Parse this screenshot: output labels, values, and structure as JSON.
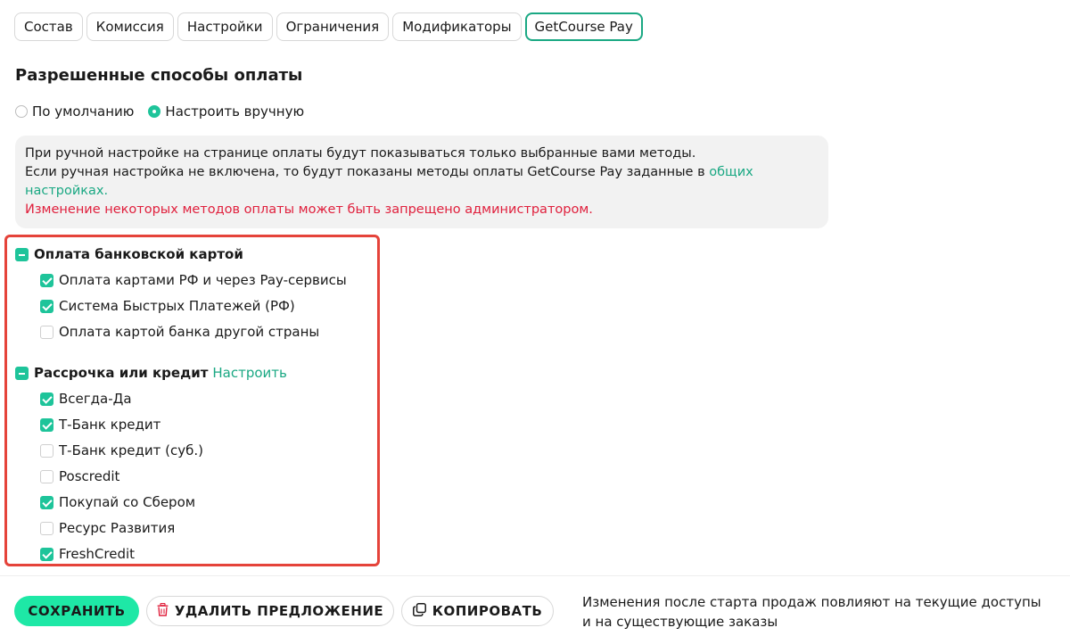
{
  "tabs": [
    {
      "label": "Состав",
      "active": false
    },
    {
      "label": "Комиссия",
      "active": false
    },
    {
      "label": "Настройки",
      "active": false
    },
    {
      "label": "Ограничения",
      "active": false
    },
    {
      "label": "Модификаторы",
      "active": false
    },
    {
      "label": "GetCourse Pay",
      "active": true
    }
  ],
  "section_title": "Разрешенные способы оплаты",
  "radio": {
    "default_label": "По умолчанию",
    "manual_label": "Настроить вручную",
    "selected": "manual"
  },
  "info": {
    "line1": "При ручной настройке на странице оплаты будут показываться только выбранные вами методы.",
    "line2_prefix": "Если ручная настройка не включена, то будут показаны методы оплаты GetCourse Pay заданные в ",
    "line2_link": "общих настройках.",
    "warning": "Изменение некоторых методов оплаты может быть запрещено администратором."
  },
  "groups": {
    "card": {
      "label": "Оплата банковской картой",
      "state": "partial",
      "items": [
        {
          "label": "Оплата картами РФ и через Pay-сервисы",
          "checked": true
        },
        {
          "label": "Система Быстрых Платежей (РФ)",
          "checked": true
        },
        {
          "label": "Оплата картой банка другой страны",
          "checked": false
        }
      ]
    },
    "credit": {
      "label": "Рассрочка или кредит",
      "config_link": "Настроить",
      "state": "partial",
      "items": [
        {
          "label": "Всегда-Да",
          "checked": true
        },
        {
          "label": "Т-Банк кредит",
          "checked": true
        },
        {
          "label": "Т-Банк кредит (суб.)",
          "checked": false
        },
        {
          "label": "Poscredit",
          "checked": false
        },
        {
          "label": "Покупай со Сбером",
          "checked": true
        },
        {
          "label": "Ресурс Развития",
          "checked": false
        },
        {
          "label": "FreshCredit",
          "checked": true
        }
      ]
    }
  },
  "footer": {
    "save_label": "СОХРАНИТЬ",
    "delete_label": "УДАЛИТЬ ПРЕДЛОЖЕНИЕ",
    "copy_label": "КОПИРОВАТЬ",
    "note_line1": "Изменения после старта продаж повлияют на текущие доступы",
    "note_line2": "и на существующие заказы"
  },
  "colors": {
    "accent": "#1ec49a",
    "save_button": "#1ee8a6",
    "warning": "#e0203d",
    "highlight_border": "#e5433a"
  },
  "icons": {
    "delete": "trash-icon",
    "copy": "copy-icon"
  }
}
